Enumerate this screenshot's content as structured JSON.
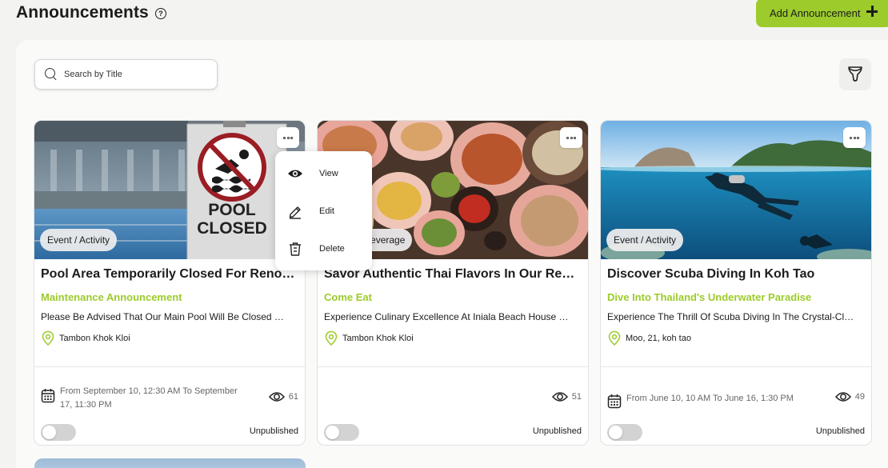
{
  "header": {
    "title": "Announcements",
    "help_icon": "question-circle-icon",
    "add_button_label": "Add Announcement",
    "add_button_color": "#9ccb2b"
  },
  "search": {
    "placeholder": "Search by Title"
  },
  "filter_icon": "funnel-icon",
  "context_menu": {
    "items": [
      {
        "label": "View",
        "icon": "eye-icon"
      },
      {
        "label": "Edit",
        "icon": "pencil-icon"
      },
      {
        "label": "Delete",
        "icon": "trash-icon"
      }
    ]
  },
  "cards": [
    {
      "image": "pool-closed-sign-photo",
      "image_text_line1": "POOL",
      "image_text_line2": "CLOSED",
      "category": "Event / Activity",
      "title": "Pool Area Temporarily Closed For Renovation",
      "subtitle": "Maintenance Announcement",
      "description": "Please Be Advised That Our Main Pool Will Be Closed For Renovation",
      "location": "Tambon Khok Kloi",
      "date_line1": "From September 10, 12:30 AM To September",
      "date_line2": "17, 11:30 PM",
      "views": "61",
      "status": "Unpublished",
      "published": false
    },
    {
      "image": "thai-food-spread-photo",
      "category": "Food & Beverage",
      "title": "Savor Authentic Thai Flavors In Our Restaurant",
      "subtitle": "Come Eat",
      "description": "Experience Culinary Excellence At Iniala Beach House Restaurant",
      "location": "Tambon Khok Kloi",
      "date_line1": "",
      "date_line2": "",
      "views": "51",
      "status": "Unpublished",
      "published": false
    },
    {
      "image": "scuba-diver-photo",
      "category": "Event / Activity",
      "title": "Discover Scuba Diving In Koh Tao",
      "subtitle": "Dive Into Thailand's Underwater Paradise",
      "description": "Experience The Thrill Of Scuba Diving In The Crystal-Clear Waters",
      "location": "Moo, 21, koh tao",
      "date_line1": "From June 10, 10 AM To June 16, 1:30 PM",
      "date_line2": "",
      "views": "49",
      "status": "Unpublished",
      "published": false
    }
  ],
  "colors": {
    "accent": "#9ccb2b",
    "background": "#f3f3f1",
    "card": "#ffffff"
  }
}
